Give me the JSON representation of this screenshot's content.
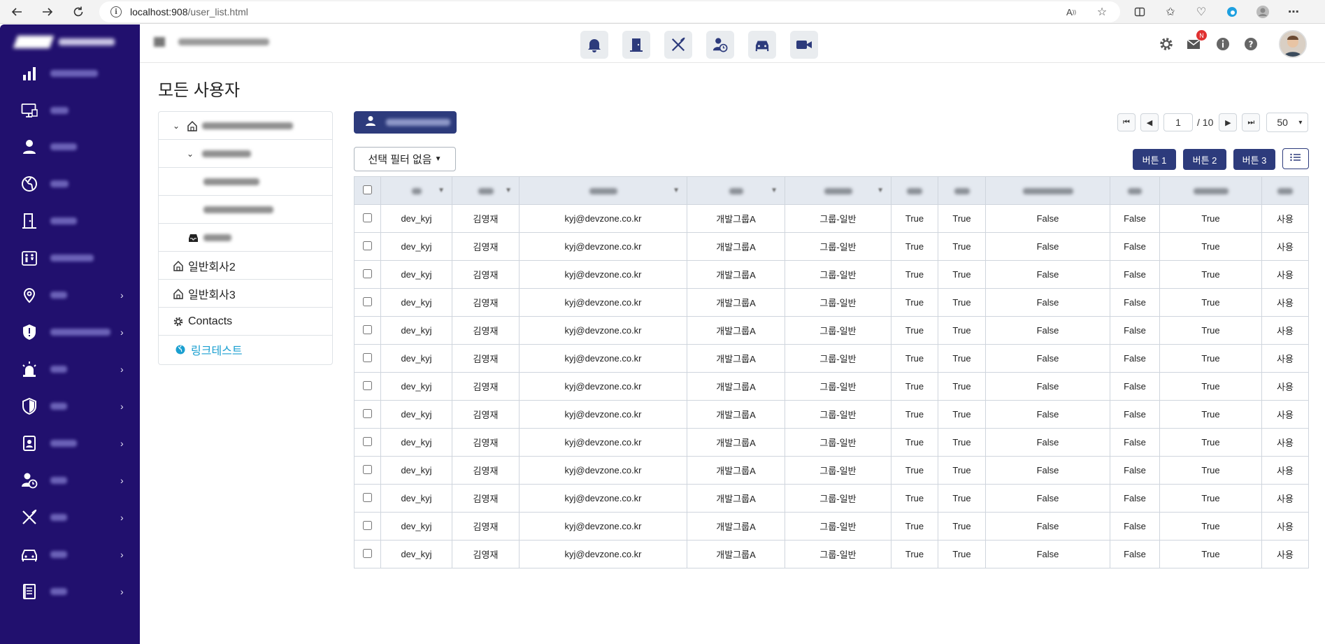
{
  "browser": {
    "url_host": "localhost:908",
    "url_path": "/user_list.html"
  },
  "sidebar": {
    "items": [
      {
        "icon": "bar-chart-icon",
        "has_children": false
      },
      {
        "icon": "monitor-icon",
        "has_children": false
      },
      {
        "icon": "user-icon",
        "has_children": false
      },
      {
        "icon": "globe-icon",
        "has_children": false
      },
      {
        "icon": "door-icon",
        "has_children": false
      },
      {
        "icon": "restroom-icon",
        "has_children": false
      },
      {
        "icon": "location-pin-icon",
        "has_children": true
      },
      {
        "icon": "shield-alert-icon",
        "has_children": true
      },
      {
        "icon": "siren-icon",
        "has_children": true
      },
      {
        "icon": "shield-icon",
        "has_children": true
      },
      {
        "icon": "id-badge-icon",
        "has_children": true
      },
      {
        "icon": "user-clock-icon",
        "has_children": true
      },
      {
        "icon": "utensils-icon",
        "has_children": true
      },
      {
        "icon": "car-icon",
        "has_children": true
      },
      {
        "icon": "document-icon",
        "has_children": true
      }
    ]
  },
  "header": {
    "center_icons": [
      "bell-icon",
      "door-icon",
      "utensils-icon",
      "user-clock-icon",
      "car-icon",
      "video-icon"
    ],
    "mail_badge": "N"
  },
  "page": {
    "title": "모든 사용자"
  },
  "tree": {
    "items": [
      {
        "label": "일반회사2"
      },
      {
        "label": "일반회사3"
      },
      {
        "label": "Contacts"
      },
      {
        "label": "링크테스트"
      }
    ]
  },
  "toolbar": {
    "filter_label": "선택 필터 없음",
    "button1": "버튼 1",
    "button2": "버튼 2",
    "button3": "버튼 3"
  },
  "pagination": {
    "current": "1",
    "total": "/ 10",
    "page_size": "50"
  },
  "table": {
    "rows": [
      [
        "dev_kyj",
        "김영재",
        "kyj@devzone.co.kr",
        "개발그룹A",
        "그룹-일반",
        "True",
        "True",
        "False",
        "False",
        "True",
        "사용"
      ],
      [
        "dev_kyj",
        "김영재",
        "kyj@devzone.co.kr",
        "개발그룹A",
        "그룹-일반",
        "True",
        "True",
        "False",
        "False",
        "True",
        "사용"
      ],
      [
        "dev_kyj",
        "김영재",
        "kyj@devzone.co.kr",
        "개발그룹A",
        "그룹-일반",
        "True",
        "True",
        "False",
        "False",
        "True",
        "사용"
      ],
      [
        "dev_kyj",
        "김영재",
        "kyj@devzone.co.kr",
        "개발그룹A",
        "그룹-일반",
        "True",
        "True",
        "False",
        "False",
        "True",
        "사용"
      ],
      [
        "dev_kyj",
        "김영재",
        "kyj@devzone.co.kr",
        "개발그룹A",
        "그룹-일반",
        "True",
        "True",
        "False",
        "False",
        "True",
        "사용"
      ],
      [
        "dev_kyj",
        "김영재",
        "kyj@devzone.co.kr",
        "개발그룹A",
        "그룹-일반",
        "True",
        "True",
        "False",
        "False",
        "True",
        "사용"
      ],
      [
        "dev_kyj",
        "김영재",
        "kyj@devzone.co.kr",
        "개발그룹A",
        "그룹-일반",
        "True",
        "True",
        "False",
        "False",
        "True",
        "사용"
      ],
      [
        "dev_kyj",
        "김영재",
        "kyj@devzone.co.kr",
        "개발그룹A",
        "그룹-일반",
        "True",
        "True",
        "False",
        "False",
        "True",
        "사용"
      ],
      [
        "dev_kyj",
        "김영재",
        "kyj@devzone.co.kr",
        "개발그룹A",
        "그룹-일반",
        "True",
        "True",
        "False",
        "False",
        "True",
        "사용"
      ],
      [
        "dev_kyj",
        "김영재",
        "kyj@devzone.co.kr",
        "개발그룹A",
        "그룹-일반",
        "True",
        "True",
        "False",
        "False",
        "True",
        "사용"
      ],
      [
        "dev_kyj",
        "김영재",
        "kyj@devzone.co.kr",
        "개발그룹A",
        "그룹-일반",
        "True",
        "True",
        "False",
        "False",
        "True",
        "사용"
      ],
      [
        "dev_kyj",
        "김영재",
        "kyj@devzone.co.kr",
        "개발그룹A",
        "그룹-일반",
        "True",
        "True",
        "False",
        "False",
        "True",
        "사용"
      ],
      [
        "dev_kyj",
        "김영재",
        "kyj@devzone.co.kr",
        "개발그룹A",
        "그룹-일반",
        "True",
        "True",
        "False",
        "False",
        "True",
        "사용"
      ]
    ]
  },
  "colors": {
    "sidebar_bg": "#21106e",
    "primary_button": "#2d3b7c",
    "header_row_bg": "#e4e9f0",
    "link": "#1a9fd0"
  }
}
